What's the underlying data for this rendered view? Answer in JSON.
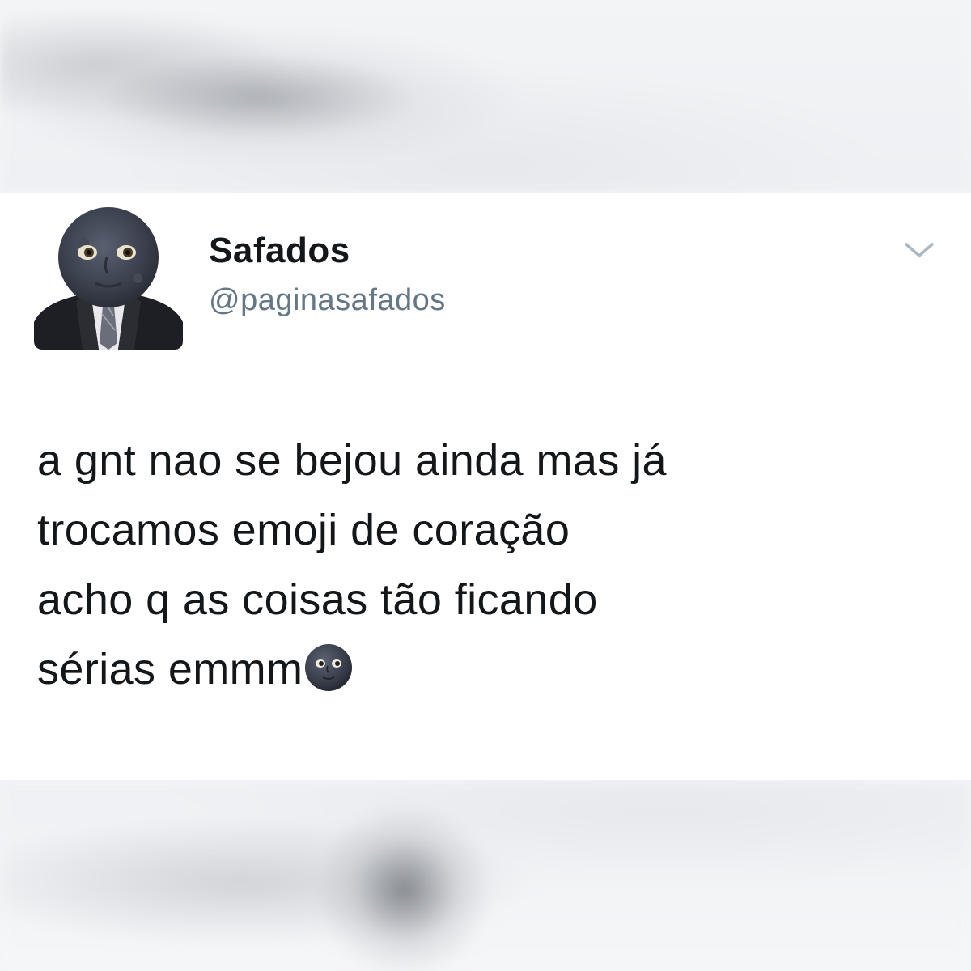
{
  "tweet": {
    "display_name": "Safados",
    "handle": "@paginasafados",
    "lines": [
      "a gnt nao se bejou ainda mas já",
      "trocamos emoji de coração",
      "acho q as coisas tão ficando",
      "sérias emmm"
    ],
    "trailing_emoji": "new-moon-face-emoji",
    "avatar": "moon-face-in-suit-avatar",
    "menu_icon": "chevron-down-icon"
  },
  "colors": {
    "text": "#14171a",
    "handle": "#657786",
    "chevron": "#aab8c2",
    "moon": "#3a3f4c"
  }
}
